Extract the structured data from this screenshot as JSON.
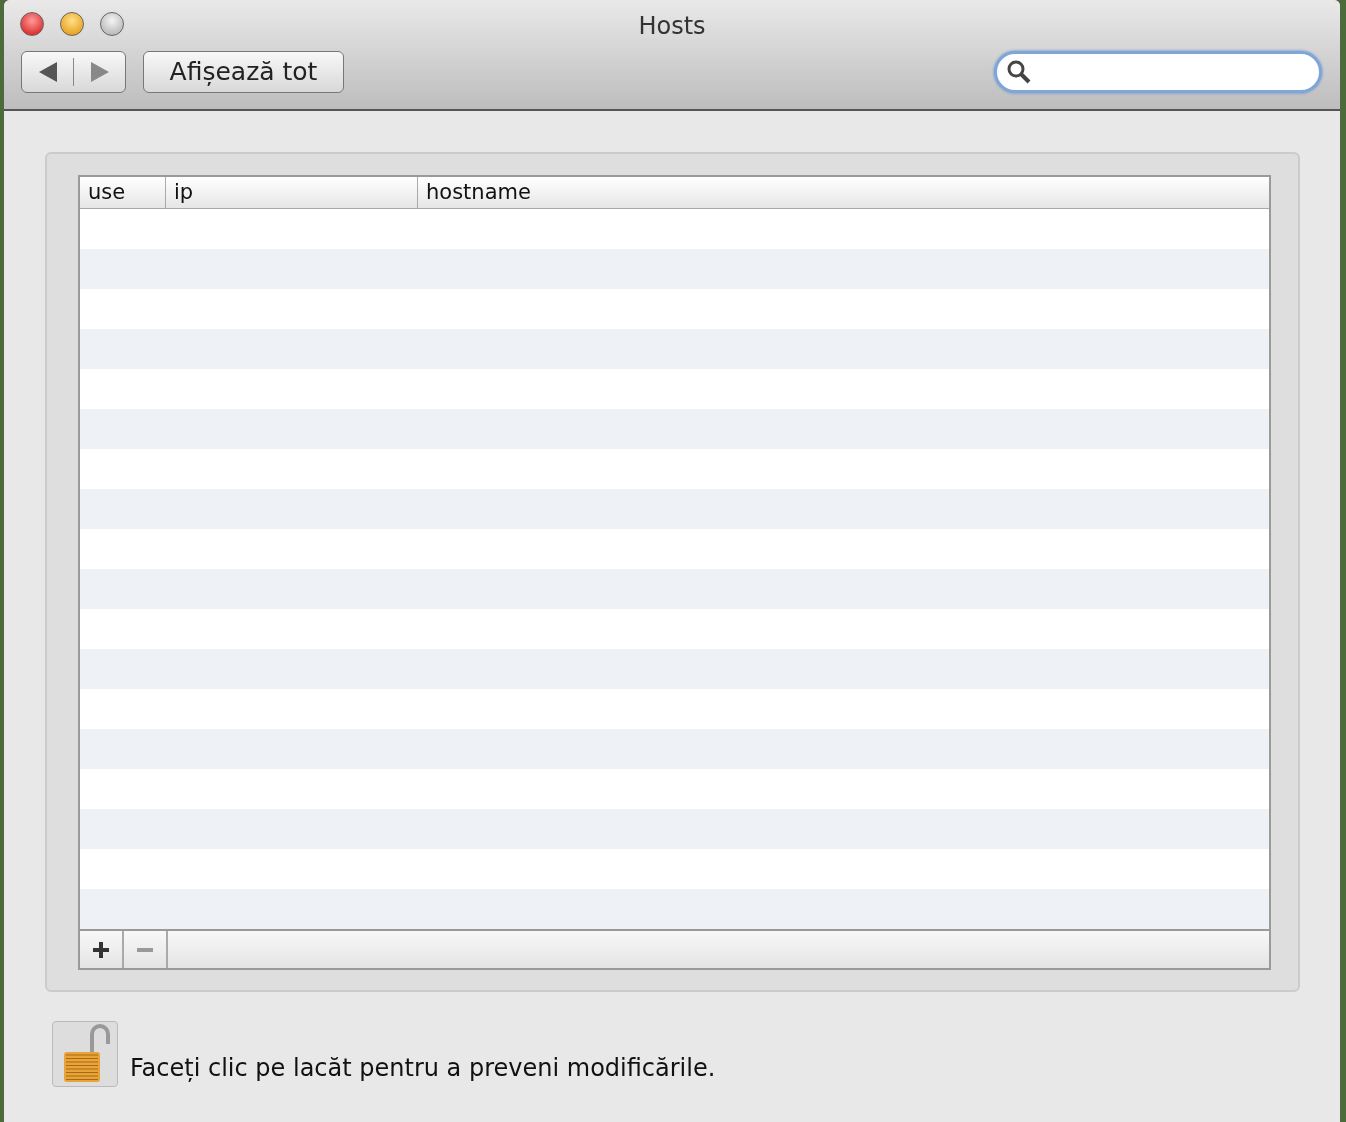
{
  "window": {
    "title": "Hosts"
  },
  "toolbar": {
    "show_all_button": "Afișează tot",
    "search": {
      "focused": true
    }
  },
  "table": {
    "columns": [
      "use",
      "ip",
      "hostname"
    ]
  },
  "table_buttons": [
    {
      "kind": "add",
      "disabled": false
    },
    {
      "kind": "remove",
      "disabled": true
    }
  ],
  "lock": {
    "locked": false,
    "message": "Faceți clic pe lacăt pentru a preveni modificările."
  }
}
